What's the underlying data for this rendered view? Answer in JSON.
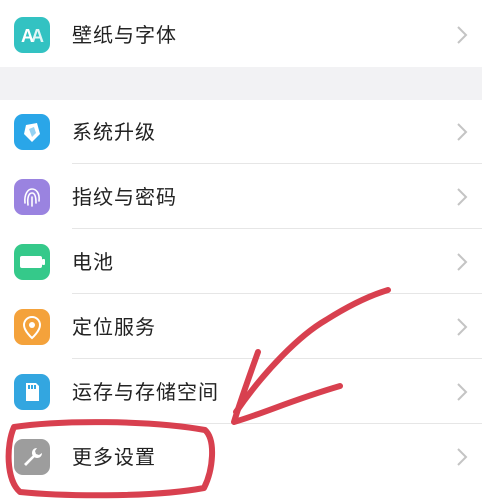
{
  "settings": {
    "top_group": [
      {
        "name": "wallpaper-font",
        "label": "壁纸与字体",
        "icon": "font-AA-icon",
        "color": "#33c2c2"
      }
    ],
    "main_group": [
      {
        "name": "system-update",
        "label": "系统升级",
        "icon": "update-arrow-icon",
        "color": "#2aa6e8"
      },
      {
        "name": "fingerprint-password",
        "label": "指纹与密码",
        "icon": "fingerprint-icon",
        "color": "#9a83e0"
      },
      {
        "name": "battery",
        "label": "电池",
        "icon": "battery-icon",
        "color": "#35c98a"
      },
      {
        "name": "location-services",
        "label": "定位服务",
        "icon": "location-pin-icon",
        "color": "#f4a23b"
      },
      {
        "name": "memory-storage",
        "label": "运存与存储空间",
        "icon": "sd-card-icon",
        "color": "#33a6e0"
      },
      {
        "name": "more-settings",
        "label": "更多设置",
        "icon": "wrench-icon",
        "color": "#9d9d9d"
      }
    ]
  },
  "annotation": {
    "color": "#d8404f"
  }
}
